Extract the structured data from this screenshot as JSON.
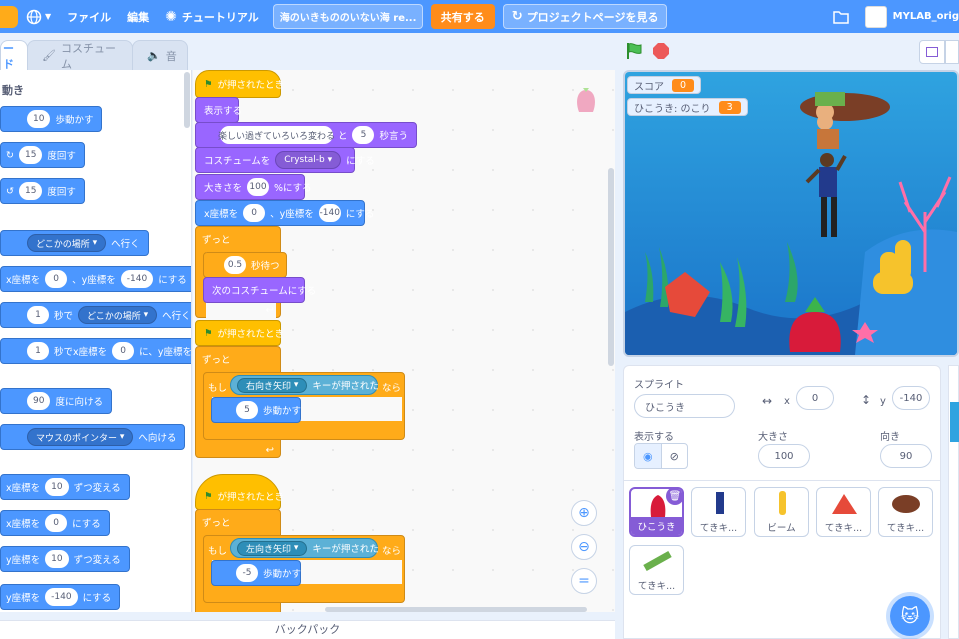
{
  "menubar": {
    "file": "ファイル",
    "edit": "編集",
    "tutorial": "チュートリアル",
    "project_title": "海のいきもののいない海 re...",
    "share": "共有する",
    "project_page": "プロジェクトページを見る",
    "username": "MYLAB_orig"
  },
  "tabs": {
    "code": "ード",
    "costume": "コスチューム",
    "sound": "音"
  },
  "palette": {
    "category": "動き",
    "blocks": {
      "move_n": "10",
      "move": "歩動かす",
      "turn_r_n": "15",
      "turn_r": "度回す",
      "turn_l_n": "15",
      "turn_l": "度回す",
      "goto_dd": "どこかの場所",
      "goto": "へ行く",
      "gotoxy_a": "x座標を",
      "gotoxy_x": "0",
      "gotoxy_b": "、y座標を",
      "gotoxy_y": "-140",
      "gotoxy_c": "にする",
      "glide1_n": "1",
      "glide1_a": "秒で",
      "glide1_dd": "どこかの場所",
      "glide1_b": "へ行く",
      "glide2_n": "1",
      "glide2_a": "秒でx座標を",
      "glide2_x": "0",
      "glide2_b": "に、y座標を",
      "point_n": "90",
      "point": "度に向ける",
      "towards_dd": "マウスのポインター",
      "towards": "へ向ける",
      "chx_a": "x座標を",
      "chx_n": "10",
      "chx_b": "ずつ変える",
      "setx_a": "x座標を",
      "setx_n": "0",
      "setx_b": "にする",
      "chy_a": "y座標を",
      "chy_n": "10",
      "chy_b": "ずつ変える",
      "sety_a": "y座標を",
      "sety_n": "-140",
      "sety_b": "にする"
    }
  },
  "script1": {
    "hat": "が押されたとき",
    "show": "表示する",
    "say_text": "楽しい過ぎていろいろ変わる",
    "say_and": "と",
    "say_n": "5",
    "say_sec": "秒言う",
    "costume_a": "コスチュームを",
    "costume_dd": "Crystal-b",
    "costume_b": "にする",
    "size_a": "大きさを",
    "size_n": "100",
    "size_b": "%にする",
    "xy_a": "x座標を",
    "xy_x": "0",
    "xy_b": "、y座標を",
    "xy_y": "-140",
    "xy_c": "にする",
    "forever": "ずっと",
    "wait_n": "0.5",
    "wait": "秒待つ",
    "next_costume": "次のコスチュームにする"
  },
  "script2": {
    "hat": "が押されたとき",
    "forever": "ずっと",
    "if": "もし",
    "key_dd": "右向き矢印",
    "key": "キーが押された",
    "then": "なら",
    "move_n": "5",
    "move": "歩動かす"
  },
  "script3": {
    "hat": "が押されたとき",
    "forever": "ずっと",
    "if": "もし",
    "key_dd": "左向き矢印",
    "key": "キーが押された",
    "then": "なら",
    "move_n": "-5",
    "move": "歩動かす"
  },
  "backpack": "バックパック",
  "stage": {
    "score_label": "スコア",
    "score_value": "0",
    "remaining_label": "ひこうき: のこり",
    "remaining_value": "3"
  },
  "sprite_info": {
    "sprite_label": "スプライト",
    "sprite_name": "ひこうき",
    "x_label": "x",
    "x_value": "0",
    "y_label": "y",
    "y_value": "-140",
    "show_label": "表示する",
    "size_label": "大きさ",
    "size_value": "100",
    "direction_label": "向き",
    "direction_value": "90"
  },
  "sprites": [
    "ひこうき",
    "てきキ...",
    "ビーム",
    "てきキ...",
    "てきキ...",
    "てきキ..."
  ],
  "colors": {
    "motion": "#4c97ff",
    "looks": "#9966ff",
    "events": "#ffbf00",
    "control": "#ffab19",
    "sensing": "#5cb1d6",
    "menubar": "#4c97ff"
  }
}
